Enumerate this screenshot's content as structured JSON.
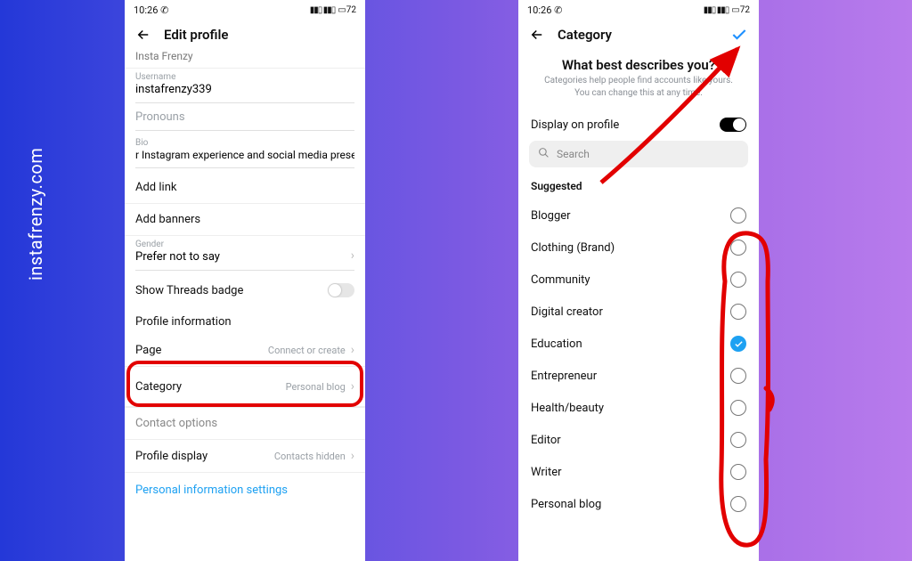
{
  "watermark": "instafrenzy.com",
  "status": {
    "time": "10:26",
    "whatsapp": "©",
    "signal": "⁴⁶ ₐᵢₗ ⁴⁶ ₐᵢₗ",
    "battery": "72"
  },
  "leftScreen": {
    "headerTitle": "Edit profile",
    "nameField": {
      "value": "Insta Frenzy"
    },
    "username": {
      "label": "Username",
      "value": "instafrenzy339"
    },
    "pronouns": {
      "label": "Pronouns"
    },
    "bio": {
      "label": "Bio",
      "value": "r Instagram experience and social media presence."
    },
    "addLink": "Add link",
    "addBanners": "Add banners",
    "gender": {
      "label": "Gender",
      "value": "Prefer not to say"
    },
    "threads": "Show Threads badge",
    "profileInfo": "Profile information",
    "page": {
      "label": "Page",
      "value": "Connect or create"
    },
    "category": {
      "label": "Category",
      "value": "Personal blog"
    },
    "contactOptions": "Contact options",
    "profileDisplay": {
      "label": "Profile display",
      "value": "Contacts hidden"
    },
    "pis": "Personal information settings"
  },
  "rightScreen": {
    "headerTitle": "Category",
    "heading": "What best describes you?",
    "sub": "Categories help people find accounts like yours. You can change this at any time.",
    "displayOnProfile": "Display on profile",
    "searchPlaceholder": "Search",
    "suggested": "Suggested",
    "items": [
      {
        "label": "Blogger",
        "selected": false
      },
      {
        "label": "Clothing (Brand)",
        "selected": false
      },
      {
        "label": "Community",
        "selected": false
      },
      {
        "label": "Digital creator",
        "selected": false
      },
      {
        "label": "Education",
        "selected": true
      },
      {
        "label": "Entrepreneur",
        "selected": false
      },
      {
        "label": "Health/beauty",
        "selected": false
      },
      {
        "label": "Editor",
        "selected": false
      },
      {
        "label": "Writer",
        "selected": false
      },
      {
        "label": "Personal blog",
        "selected": false
      }
    ]
  },
  "colors": {
    "annotation": "#e20000",
    "link": "#1ea1f2"
  }
}
